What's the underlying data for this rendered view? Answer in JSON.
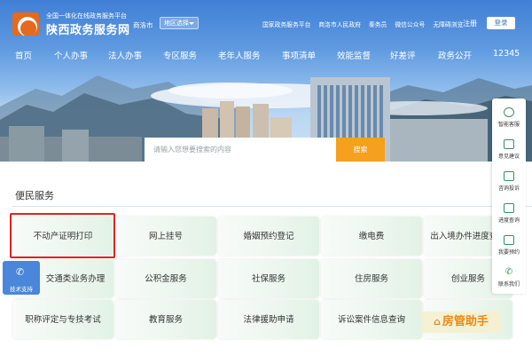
{
  "header": {
    "site_subtitle": "全国一体化在线政务服务平台",
    "site_name": "陕西政务服务网",
    "city": "商洛市",
    "region_select": "地区选择",
    "top_links": [
      "国家政务服务平台",
      "商洛市人民政府",
      "秦务员",
      "微信公众号",
      "无障碍浏览"
    ],
    "register": "注册",
    "login": "登录"
  },
  "nav": {
    "items": [
      "首页",
      "个人办事",
      "法人办事",
      "专区服务",
      "老年人服务",
      "事项清单",
      "效能监督",
      "好差评",
      "政务公开",
      "12345"
    ]
  },
  "search": {
    "placeholder": "请输入您想要搜索的内容",
    "button": "搜索"
  },
  "section": {
    "title": "便民服务"
  },
  "services": [
    "不动产证明打印",
    "网上挂号",
    "婚姻预约登记",
    "缴电费",
    "出入境办件进度查询",
    "交通类业务办理",
    "公积金服务",
    "社保服务",
    "住房服务",
    "创业服务",
    "职称评定与专技考试",
    "教育服务",
    "法律援助申请",
    "诉讼案件信息查询",
    ""
  ],
  "tech_support": "技术支持",
  "sidebar": {
    "items": [
      "智能客服",
      "意见建议",
      "咨询投诉",
      "进度查询",
      "我要预约",
      "联系我们"
    ]
  },
  "watermark": "房管助手",
  "colors": {
    "header_blue": "#3f7fd6",
    "search_orange": "#f5a01e",
    "highlight_red": "#e32222",
    "rail_green": "#3c8f5c"
  }
}
